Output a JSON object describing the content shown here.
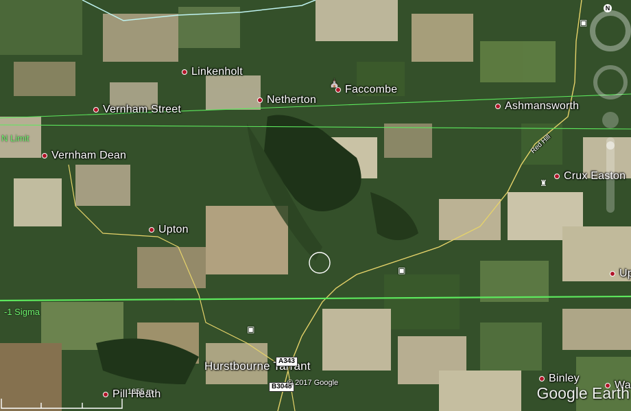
{
  "places": {
    "linkenholt": "Linkenholt",
    "netherton": "Netherton",
    "faccombe": "Faccombe",
    "vernham_street": "Vernham Street",
    "ashmansworth": "Ashmansworth",
    "vernham_dean": "Vernham Dean",
    "crux_easton": "Crux Easton",
    "upton": "Upton",
    "upton_right": "Up",
    "hurstbourne_tarrant": "Hurstbourne Tarrant",
    "binley": "Binley",
    "pill_heath": "Pill Heath",
    "wa": "Wa"
  },
  "roads": {
    "red_hill": "Red Hill",
    "a343": "A343",
    "b3048": "B3048"
  },
  "lines": {
    "n_limit": "N Limit",
    "sigma": "-1 Sigma"
  },
  "overlay": {
    "copyright": "© 2017 Google",
    "brand": "Google Earth",
    "scale": "1855 m",
    "compass": "N"
  },
  "colors": {
    "limit_line": "#5de85d",
    "road": "#e6d36a",
    "boundary": "#bff3f0",
    "pin": "#b0162a"
  }
}
